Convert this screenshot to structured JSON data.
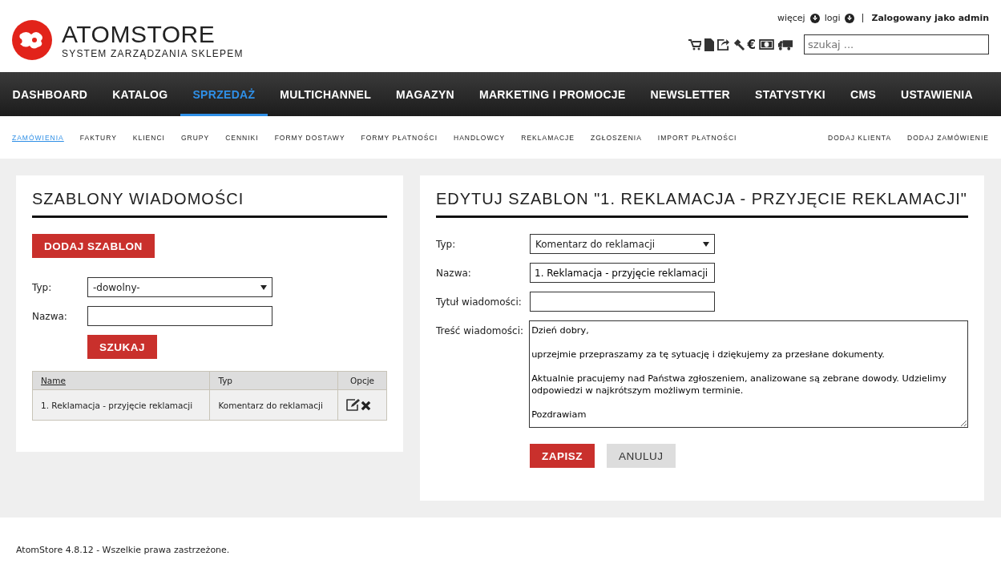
{
  "logo": {
    "name": "ATOMSTORE",
    "tagline": "SYSTEM ZARZĄDZANIA SKLEPEM"
  },
  "top_links": [
    {
      "label": "więcej"
    },
    {
      "label": "logi"
    }
  ],
  "user": "Zalogowany jako admin",
  "toolbar": {
    "euro": "€"
  },
  "search": {
    "placeholder": "szukaj ..."
  },
  "main_nav": [
    {
      "label": "DASHBOARD",
      "selected": false
    },
    {
      "label": "KATALOG",
      "selected": false
    },
    {
      "label": "SPRZEDAŻ",
      "selected": true
    },
    {
      "label": "MULTICHANNEL",
      "selected": false
    },
    {
      "label": "MAGAZYN",
      "selected": false
    },
    {
      "label": "MARKETING I PROMOCJE",
      "selected": false
    },
    {
      "label": "NEWSLETTER",
      "selected": false
    },
    {
      "label": "STATYSTYKI",
      "selected": false
    },
    {
      "label": "CMS",
      "selected": false
    },
    {
      "label": "USTAWIENIA",
      "selected": false
    }
  ],
  "sub_nav": [
    {
      "label": "ZAMÓWIENIA",
      "selected": true
    },
    {
      "label": "FAKTURY",
      "selected": false
    },
    {
      "label": "KLIENCI",
      "selected": false
    },
    {
      "label": "GRUPY",
      "selected": false
    },
    {
      "label": "CENNIKI",
      "selected": false
    },
    {
      "label": "FORMY DOSTAWY",
      "selected": false
    },
    {
      "label": "FORMY PŁATNOŚCI",
      "selected": false
    },
    {
      "label": "HANDLOWCY",
      "selected": false
    },
    {
      "label": "REKLAMACJE",
      "selected": false
    },
    {
      "label": "ZGŁOSZENIA",
      "selected": false
    },
    {
      "label": "IMPORT PŁATNOŚCI",
      "selected": false
    }
  ],
  "sub_actions": [
    "DODAJ KLIENTA",
    "DODAJ ZAMÓWIENIE"
  ],
  "left_panel": {
    "title": "SZABLONY WIADOMOŚCI",
    "add_button": "DODAJ SZABLON",
    "type_label": "Typ:",
    "type_value": "-dowolny-",
    "name_label": "Nazwa:",
    "search_button": "SZUKAJ",
    "table": {
      "columns": [
        "Name",
        "Typ",
        "Opcje"
      ],
      "rows": [
        {
          "name": "1. Reklamacja - przyjęcie reklamacji",
          "type": "Komentarz do reklamacji"
        }
      ]
    }
  },
  "right_panel": {
    "title": "EDYTUJ SZABLON \"1. REKLAMACJA - PRZYJĘCIE REKLAMACJI\"",
    "fields": [
      {
        "kind": "select",
        "label": "Typ:",
        "value": "Komentarz do reklamacji"
      },
      {
        "kind": "text",
        "label": "Nazwa:",
        "value": "1. Reklamacja - przyjęcie reklamacji"
      },
      {
        "kind": "text",
        "label": "Tytuł wiadomości:"
      },
      {
        "kind": "textarea",
        "label": "Treść wiadomości:",
        "value": "Dzień dobry,\n\nuprzejmie przepraszamy za tę sytuację i dziękujemy za przesłane dokumenty.\n\nAktualnie pracujemy nad Państwa zgłoszeniem, analizowane są zebrane dowody. Udzielimy odpowiedzi w najkrótszym możliwym terminie.\n\nPozdrawiam"
      }
    ],
    "save_button": "ZAPISZ",
    "cancel_button": "ANULUJ"
  },
  "footer": "AtomStore 4.8.12 - Wszelkie prawa zastrzeżone."
}
